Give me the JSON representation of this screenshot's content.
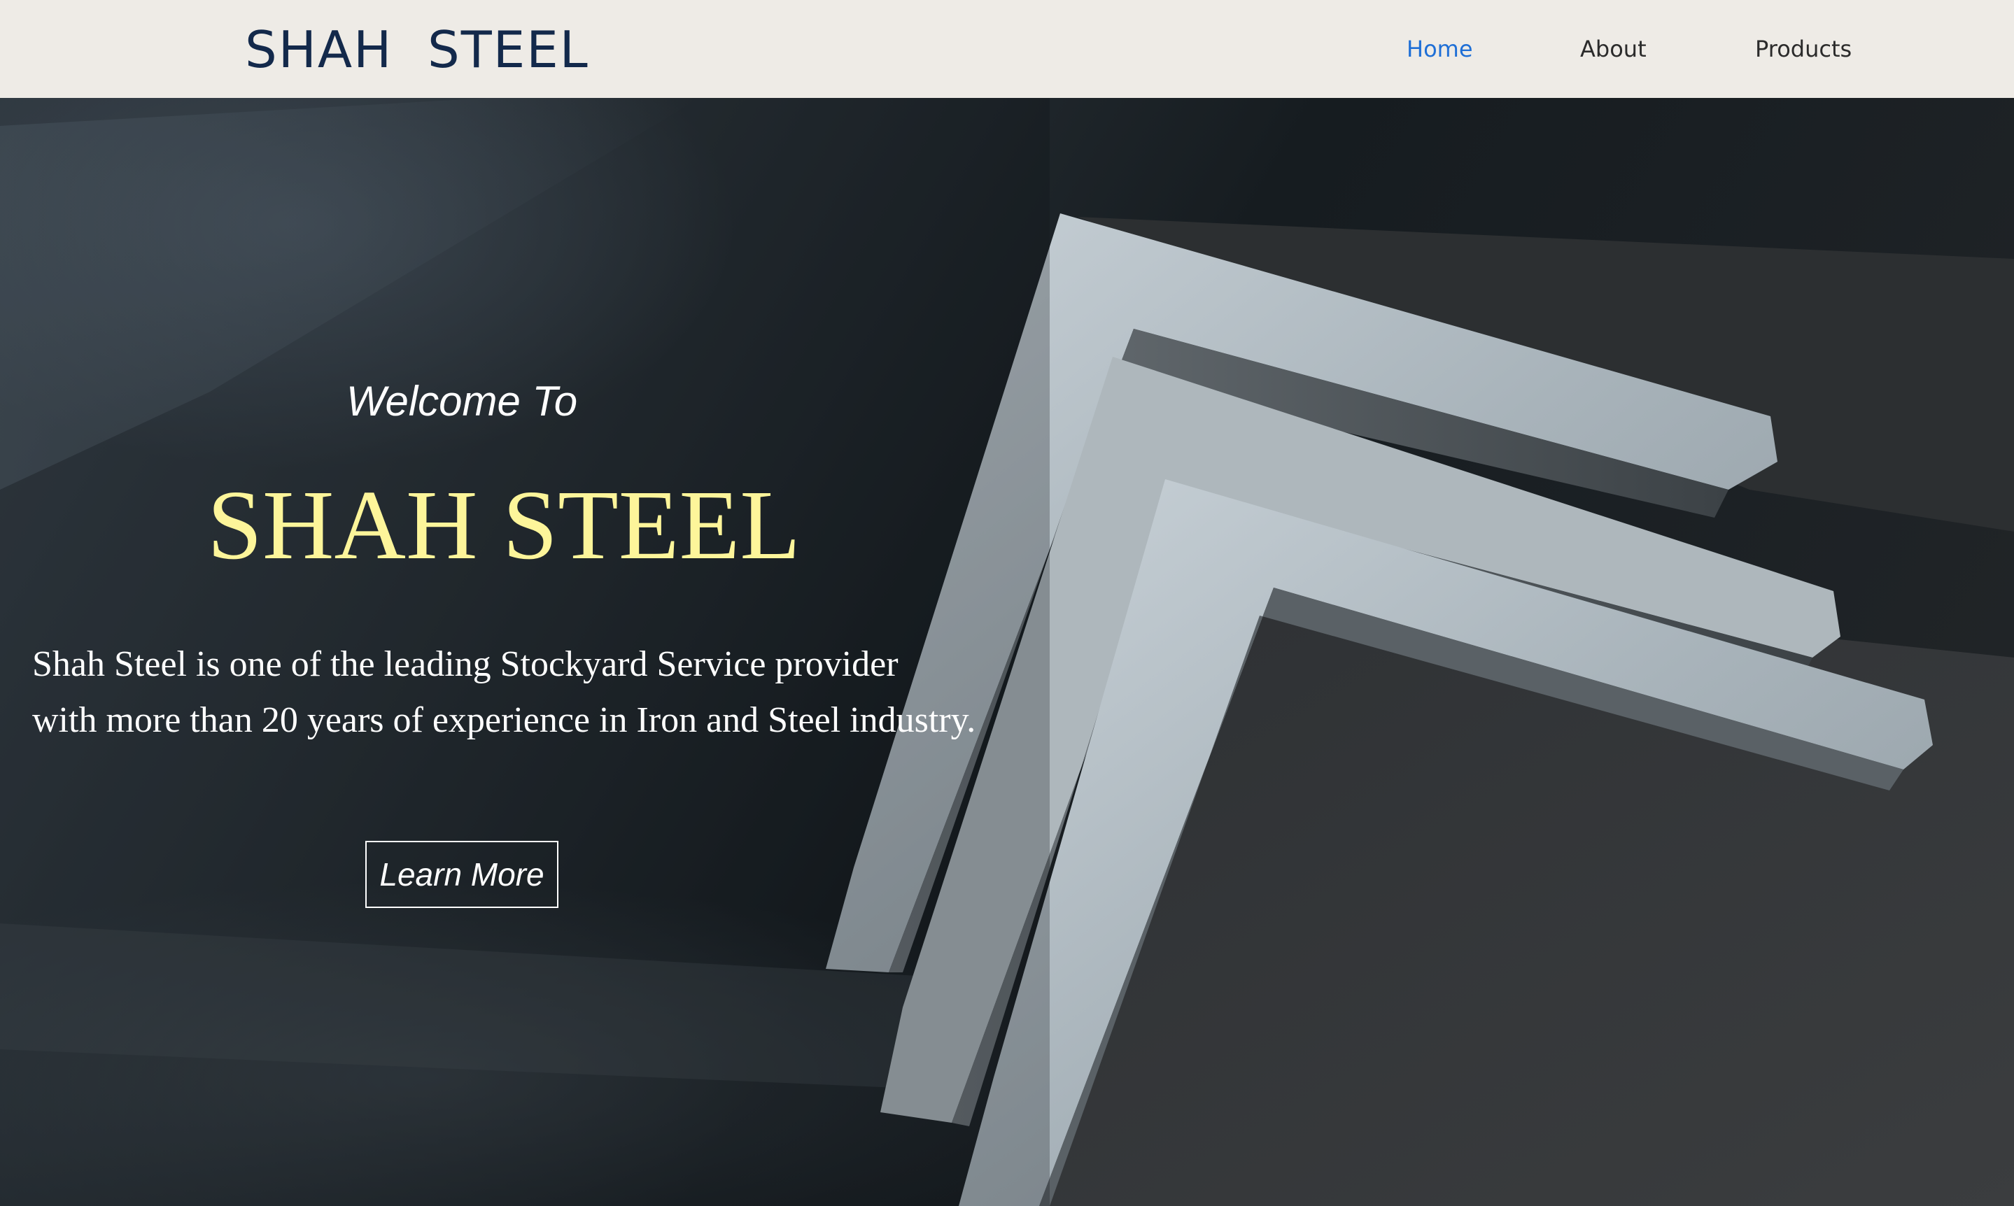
{
  "header": {
    "brand": "SHAH  STEEL",
    "nav": [
      {
        "label": "Home",
        "active": true
      },
      {
        "label": "About",
        "active": false
      },
      {
        "label": "Products",
        "active": false
      }
    ]
  },
  "hero": {
    "welcome": "Welcome To",
    "title": "SHAH STEEL",
    "description_lines": [
      "Shah Steel is one of the leading Stockyard Service provider",
      "with more than 20 years of experience in Iron and Steel industry."
    ],
    "cta_label": "Learn More",
    "background_image": "steel-angle-bars-photo"
  },
  "colors": {
    "header_bg": "#eeebe6",
    "brand": "#13294b",
    "nav_active": "#1f6fd6",
    "nav_text": "#2b2b2b",
    "hero_title": "#fdf59a",
    "hero_text": "#ffffff"
  }
}
